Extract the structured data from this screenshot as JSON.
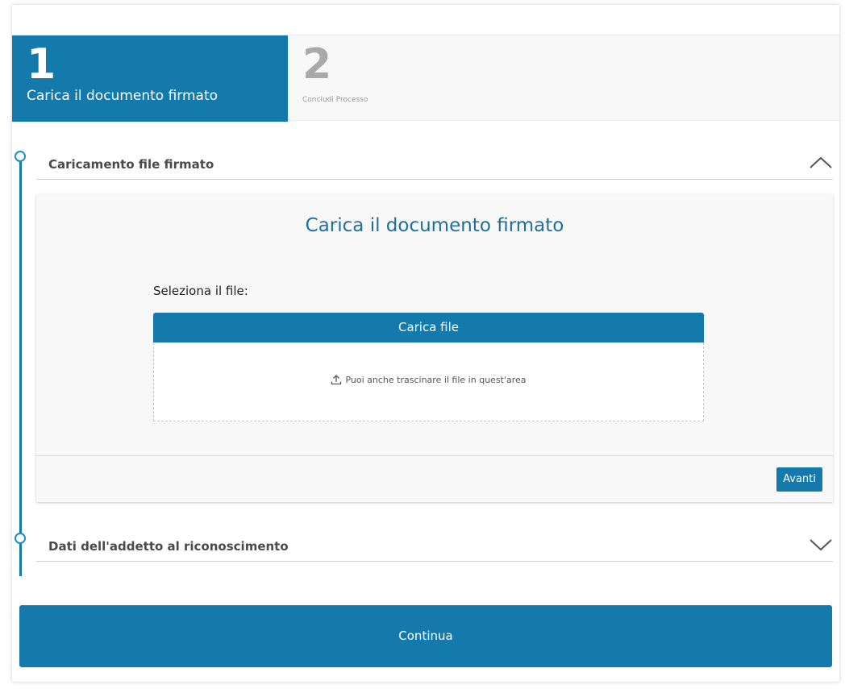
{
  "stepper": {
    "steps": [
      {
        "number": "1",
        "label": "Carica il documento firmato",
        "active": true
      },
      {
        "number": "2",
        "label": "Concludi Processo",
        "active": false
      }
    ]
  },
  "sections": [
    {
      "title": "Caricamento file firmato",
      "expanded": true,
      "chevron": "chevron-up-icon"
    },
    {
      "title": "Dati dell'addetto al riconoscimento",
      "expanded": false,
      "chevron": "chevron-down-icon"
    }
  ],
  "upload_panel": {
    "title": "Carica il documento firmato",
    "select_label": "Seleziona il file:",
    "upload_button": "Carica file",
    "drop_hint": "Puoi anche trascinare il file in quest'area",
    "drop_icon": "upload-icon",
    "next_button": "Avanti"
  },
  "continue_button": "Continua",
  "colors": {
    "primary": "#1479ab",
    "title_blue": "#1f6f9c",
    "timeline_dot": "#1a90c7",
    "inactive_step": "#a9a9a9"
  }
}
